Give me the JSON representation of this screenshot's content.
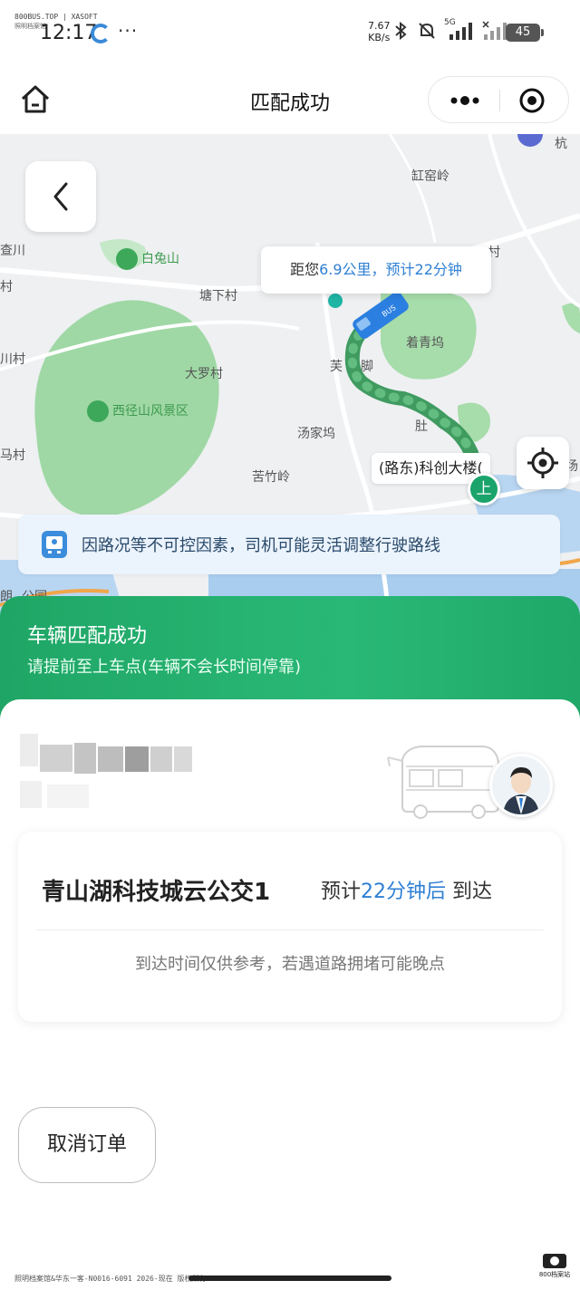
{
  "status_bar": {
    "watermark_line1": "800BUS.TOP | XASOFT",
    "watermark_line2": "照明档案馆",
    "time": "12:17",
    "dots": "···",
    "speed_value": "7.67",
    "speed_unit": "KB/s",
    "network": "5G",
    "battery": "45"
  },
  "header": {
    "title": "匹配成功"
  },
  "map": {
    "labels": {
      "gangyaoling": "缸窑岭",
      "chachuan": "查川",
      "baitushan": "白兔山",
      "cun_right": "村",
      "cun_left": "村",
      "tangxiacun": "塘下村",
      "shanchuancun": "川村",
      "zhuoqingwu": "着青坞",
      "daluocun": "大罗村",
      "fu": "芙",
      "jiao": "脚",
      "xijingshan": "西径山风景区",
      "tangjiawu": "汤家坞",
      "du": "肚",
      "maluocun": "马村",
      "kuzhuling": "苦竹岭",
      "chang": "场",
      "hang": "杭",
      "lang": "朗",
      "yuan": "公园"
    },
    "eta_prefix": "距您",
    "eta_distance": "6.9公里",
    "eta_sep": "，",
    "eta_time": "预计22分钟",
    "stop_label": "(路东)科创大楼(",
    "boarding_marker": "上",
    "notice": "因路况等不可控因素，司机可能灵活调整行驶路线"
  },
  "success": {
    "title": "车辆匹配成功",
    "subtitle": "请提前至上车点(车辆不会长时间停靠)"
  },
  "trip": {
    "route_name": "青山湖科技城云公交1",
    "eta_prefix": "预计",
    "eta_time": "22分钟后",
    "eta_suffix": "到达",
    "note": "到达时间仅供参考，若遇道路拥堵可能晚点"
  },
  "actions": {
    "cancel": "取消订单"
  },
  "footer": {
    "watermark": "照明档案馆&华东一客-N0016-6091 2026-现在 版权所有",
    "logo_text": "800档案站"
  },
  "colors": {
    "accent_green": "#1fa666",
    "route_green": "#4aa86a",
    "link_blue": "#2f7fd4",
    "notice_bg": "#ebf3fc"
  },
  "icons": {
    "home": "home-icon",
    "more": "more-dots-icon",
    "close_mini": "target-circle-icon",
    "back": "chevron-left-icon",
    "locate": "locate-crosshair-icon",
    "bus_notice": "bus-icon",
    "driver": "driver-avatar"
  }
}
